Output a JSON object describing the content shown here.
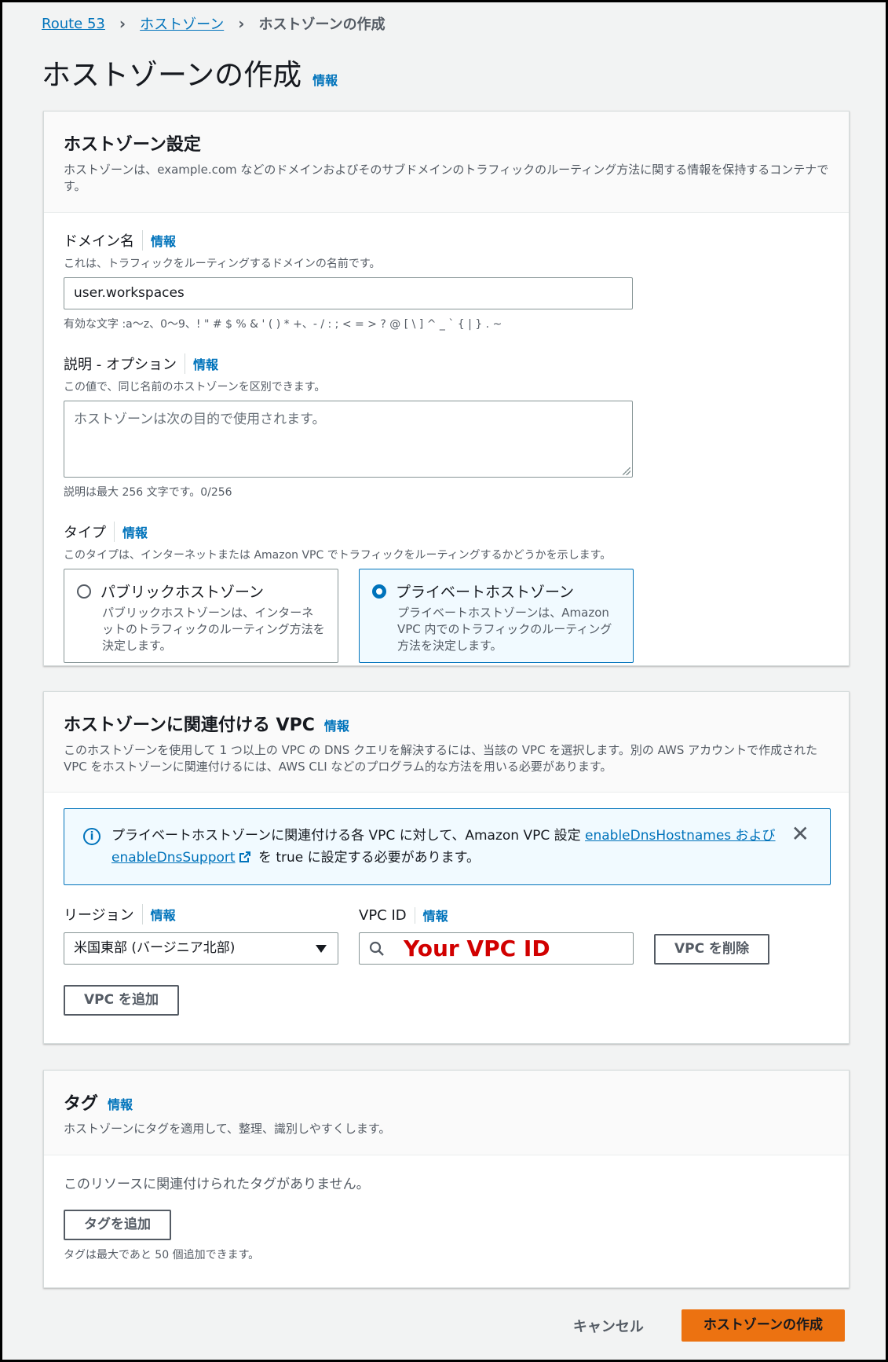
{
  "breadcrumb": {
    "items": [
      "Route 53",
      "ホストゾーン"
    ],
    "current": "ホストゾーンの作成"
  },
  "page": {
    "title": "ホストゾーンの作成",
    "info": "情報"
  },
  "config_panel": {
    "title": "ホストゾーン設定",
    "description": "ホストゾーンは、example.com などのドメインおよびそのサブドメインのトラフィックのルーティング方法に関する情報を保持するコンテナです。",
    "domain": {
      "label": "ドメイン名",
      "info": "情報",
      "description": "これは、トラフィックをルーティングするドメインの名前です。",
      "value": "user.workspaces",
      "constraint": "有効な文字 :a〜z、0〜9、! \" # $ % & ' ( ) * +、- / : ; < = > ? @ [ \\ ] ^ _ ` { | } . ~"
    },
    "description_field": {
      "label": "説明 - オプション",
      "info": "情報",
      "description": "この値で、同じ名前のホストゾーンを区別できます。",
      "placeholder": "ホストゾーンは次の目的で使用されます。",
      "constraint": "説明は最大 256 文字です。0/256"
    },
    "type": {
      "label": "タイプ",
      "info": "情報",
      "description": "このタイプは、インターネットまたは Amazon VPC でトラフィックをルーティングするかどうかを示します。",
      "options": [
        {
          "title": "パブリックホストゾーン",
          "description": "パブリックホストゾーンは、インターネットのトラフィックのルーティング方法を決定します。",
          "selected": false
        },
        {
          "title": "プライベートホストゾーン",
          "description": "プライベートホストゾーンは、Amazon VPC 内でのトラフィックのルーティング方法を決定します。",
          "selected": true
        }
      ]
    }
  },
  "vpc_panel": {
    "title": "ホストゾーンに関連付ける VPC",
    "info": "情報",
    "description": "このホストゾーンを使用して 1 つ以上の VPC の DNS クエリを解決するには、当該の VPC を選択します。別の AWS アカウントで作成された VPC をホストゾーンに関連付けるには、AWS CLI などのプログラム的な方法を用いる必要があります。",
    "alert": {
      "text_before": "プライベートホストゾーンに関連付ける各 VPC に対して、Amazon VPC 設定 ",
      "link": "enableDnsHostnames および enableDnsSupport",
      "text_after": " を true に設定する必要があります。"
    },
    "region": {
      "label": "リージョン",
      "info": "情報",
      "value": "米国東部 (バージニア北部)"
    },
    "vpc_id": {
      "label": "VPC ID",
      "info": "情報",
      "value": "Your VPC ID"
    },
    "remove_button": "VPC を削除",
    "add_button": "VPC を追加"
  },
  "tags_panel": {
    "title": "タグ",
    "info": "情報",
    "description": "ホストゾーンにタグを適用して、整理、識別しやすくします。",
    "empty_text": "このリソースに関連付けられたタグがありません。",
    "add_button": "タグを追加",
    "limit_text": "タグは最大であと 50 個追加できます。"
  },
  "footer": {
    "cancel": "キャンセル",
    "create": "ホストゾーンの作成"
  },
  "colors": {
    "link": "#0073bb",
    "primary": "#ec7211",
    "vpc_id_text": "#d10000"
  }
}
